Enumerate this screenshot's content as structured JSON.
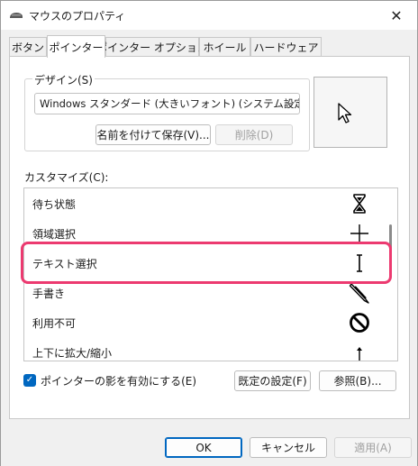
{
  "window": {
    "title": "マウスのプロパティ",
    "close_symbol": "✕"
  },
  "tabs": [
    {
      "label": "ボタン",
      "active": false
    },
    {
      "label": "ポインター",
      "active": true
    },
    {
      "label": "ポインター オプション",
      "active": false
    },
    {
      "label": "ホイール",
      "active": false
    },
    {
      "label": "ハードウェア",
      "active": false
    }
  ],
  "design": {
    "label": "デザイン(S)",
    "scheme_value": "Windows スタンダード (大きいフォント) (システム設定)",
    "save_as_label": "名前を付けて保存(V)...",
    "delete_label": "削除(D)"
  },
  "customize": {
    "label": "カスタマイズ(C):",
    "rows": [
      {
        "label": "待ち状態",
        "icon": "hourglass-icon"
      },
      {
        "label": "領域選択",
        "icon": "crosshair-icon"
      },
      {
        "label": "テキスト選択",
        "icon": "text-beam-icon"
      },
      {
        "label": "手書き",
        "icon": "pen-icon"
      },
      {
        "label": "利用不可",
        "icon": "unavailable-icon"
      },
      {
        "label": "上下に拡大/縮小",
        "icon": "vertical-resize-icon"
      }
    ]
  },
  "shadow": {
    "label": "ポインターの影を有効にする(E)",
    "checked": true
  },
  "buttons": {
    "default_label": "既定の設定(F)",
    "browse_label": "参照(B)...",
    "ok_label": "OK",
    "cancel_label": "キャンセル",
    "apply_label": "適用(A)"
  },
  "colors": {
    "accent": "#0067c0",
    "highlight": "#ec3a70"
  }
}
